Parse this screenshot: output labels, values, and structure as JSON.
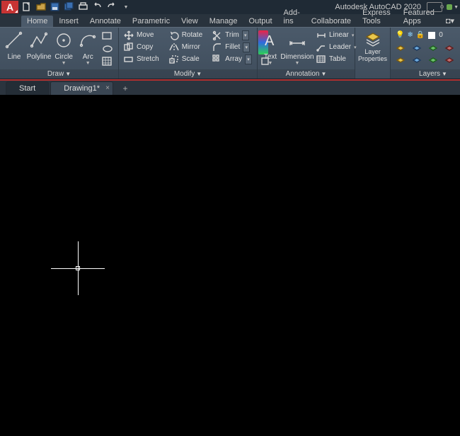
{
  "app": {
    "title": "Autodesk AutoCAD 2020",
    "logo_letter": "A"
  },
  "qat_icons": [
    "new",
    "open",
    "save",
    "saveall",
    "plot",
    "undo",
    "redo"
  ],
  "menubar": {
    "tabs": [
      "Home",
      "Insert",
      "Annotate",
      "Parametric",
      "View",
      "Manage",
      "Output",
      "Add-ins",
      "Collaborate",
      "Express Tools",
      "Featured Apps"
    ],
    "active": 0
  },
  "ribbon": {
    "draw": {
      "title": "Draw",
      "line": "Line",
      "polyline": "Polyline",
      "circle": "Circle",
      "arc": "Arc"
    },
    "modify": {
      "title": "Modify",
      "move": "Move",
      "copy": "Copy",
      "stretch": "Stretch",
      "rotate": "Rotate",
      "mirror": "Mirror",
      "scale": "Scale",
      "trim": "Trim",
      "fillet": "Fillet",
      "array": "Array"
    },
    "annotation": {
      "title": "Annotation",
      "text": "Text",
      "dimension": "Dimension",
      "linear": "Linear",
      "leader": "Leader",
      "table": "Table"
    },
    "layers": {
      "title": "Layers",
      "layer_properties": "Layer\nProperties",
      "current": "0"
    }
  },
  "filetabs": {
    "start": "Start",
    "drawing": "Drawing1*",
    "add": "+"
  }
}
